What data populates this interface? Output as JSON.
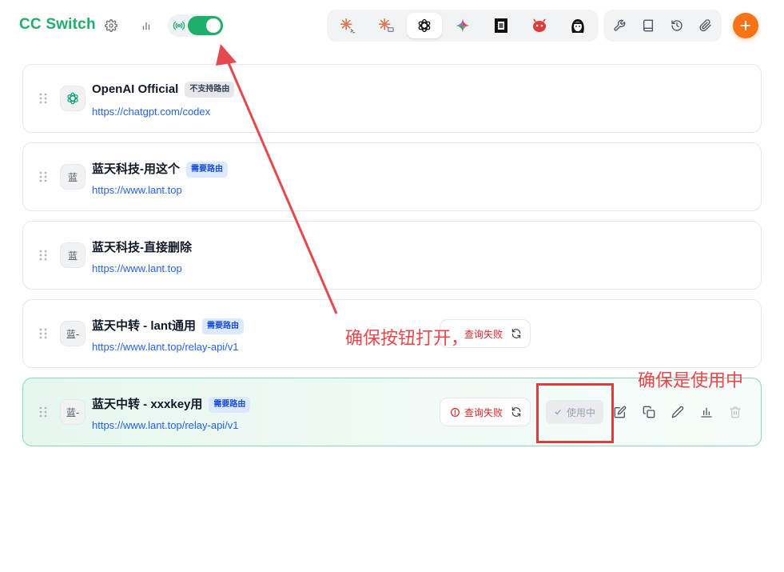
{
  "header": {
    "title": "CC Switch",
    "settings_icon": "gear-icon",
    "stats_icon": "bar-chart-icon",
    "proxy_toggle": {
      "icon": "signal-icon",
      "on": true,
      "color": "#1fae6b"
    },
    "apps": [
      {
        "name": "claude-code",
        "icon": "claude-terminal-icon",
        "active": false
      },
      {
        "name": "claude-desktop",
        "icon": "claude-desktop-icon",
        "active": false
      },
      {
        "name": "codex",
        "icon": "openai-icon",
        "active": true
      },
      {
        "name": "gemini",
        "icon": "gemini-icon",
        "active": false
      },
      {
        "name": "opencode",
        "icon": "opencode-icon",
        "active": false
      },
      {
        "name": "app-6",
        "icon": "red-blob-icon",
        "active": false
      },
      {
        "name": "app-7",
        "icon": "avatar-girl-icon",
        "active": false
      }
    ],
    "tools": [
      "wrench-icon",
      "book-icon",
      "history-icon",
      "paperclip-icon"
    ],
    "add_icon": "plus-icon",
    "accent": "#f97316"
  },
  "providers": [
    {
      "name": "OpenAI Official",
      "badge": "不支持路由",
      "badge_style": "gray",
      "url": "https://chatgpt.com/codex",
      "icon": "openai-icon",
      "icon_text": ""
    },
    {
      "name": "蓝天科技-用这个",
      "badge": "需要路由",
      "badge_style": "blue",
      "url": "https://www.lant.top",
      "icon": "text-icon",
      "icon_text": "蓝"
    },
    {
      "name": "蓝天科技-直接删除",
      "badge": "",
      "badge_style": "",
      "url": "https://www.lant.top",
      "icon": "text-icon",
      "icon_text": "蓝"
    },
    {
      "name": "蓝天中转 - lant通用",
      "badge": "需要路由",
      "badge_style": "blue",
      "url": "https://www.lant.top/relay-api/v1",
      "icon": "text-icon",
      "icon_text": "蓝-",
      "query_status": "查询失败"
    },
    {
      "name": "蓝天中转 - xxxkey用",
      "badge": "需要路由",
      "badge_style": "blue",
      "url": "https://www.lant.top/relay-api/v1",
      "icon": "text-icon",
      "icon_text": "蓝-",
      "query_status": "查询失败",
      "current": true,
      "use_label": "使用中"
    }
  ],
  "annotations": {
    "toggle_note": "确保按钮打开，",
    "in_use_note": "确保是使用中",
    "color": "#e5484d"
  }
}
